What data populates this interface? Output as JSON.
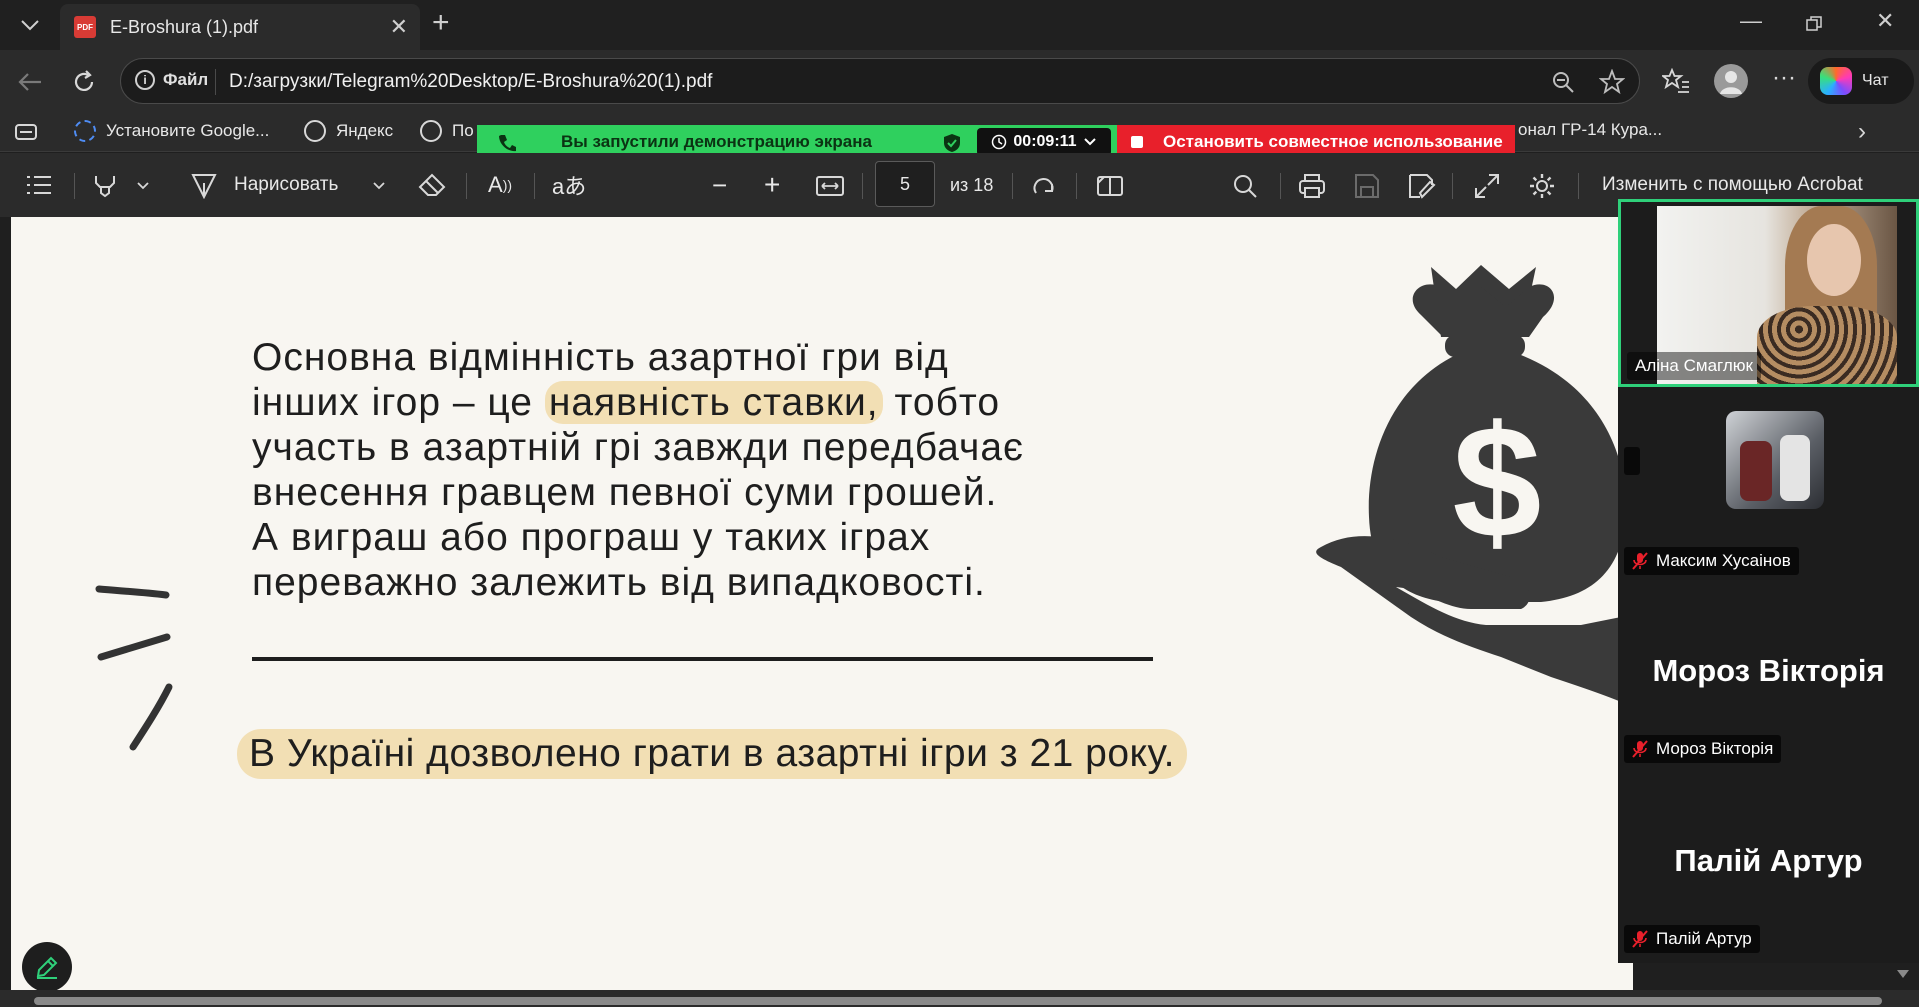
{
  "browser": {
    "tab_title": "E-Broshura (1).pdf",
    "tab_icon": "PDF",
    "new_tab_glyph": "+",
    "address": {
      "info_label": "Файл",
      "url": "D:/загрузки/Telegram%20Desktop/E-Broshura%20(1).pdf"
    },
    "copilot_label": "Чат",
    "bookmarks": [
      {
        "label": "Установите Google..."
      },
      {
        "label": "Яндекс"
      },
      {
        "label": "По"
      },
      {
        "label": "онал ГР-14 Кура..."
      }
    ]
  },
  "screen_share": {
    "status": "Вы запустили демонстрацию экрана",
    "timer": "00:09:11",
    "stop_label": "Остановить совместное использование"
  },
  "pdf_toolbar": {
    "draw_label": "Нарисовать",
    "current_page": "5",
    "total_pages": "из 18",
    "acrobat_label": "Изменить с помощью Acrobat"
  },
  "pdf_page": {
    "line1": "Основна відмінність азартної гри від",
    "line2_before": "інших ігор – це ",
    "line2_highlight": "наявність ставки,",
    "line2_after": " тобто",
    "line3": "участь в азартній грі завжди передбачає",
    "line4": "внесення гравцем певної суми грошей.",
    "line5": "А виграш або програш у таких іграх",
    "line6": "переважно залежить від випадковості.",
    "note": "В Україні дозволено грати в азартні ігри з 21 року.",
    "illustration_glyph": "$"
  },
  "participants": [
    {
      "name": "Аліна Смаглюк",
      "video": true,
      "active": true
    },
    {
      "name": "Максим Хусаінов",
      "avatar": true,
      "muted": true
    },
    {
      "name": "Мороз Вікторія",
      "display_name": "Мороз Вікторія",
      "muted": true
    },
    {
      "name": "Палій Артур",
      "display_name": "Палій Артур",
      "muted": true
    }
  ],
  "colors": {
    "accent_green": "#2fd05e",
    "stop_red": "#e8202b",
    "highlight": "#f2dfb4",
    "page_bg": "#f8f6f1"
  }
}
